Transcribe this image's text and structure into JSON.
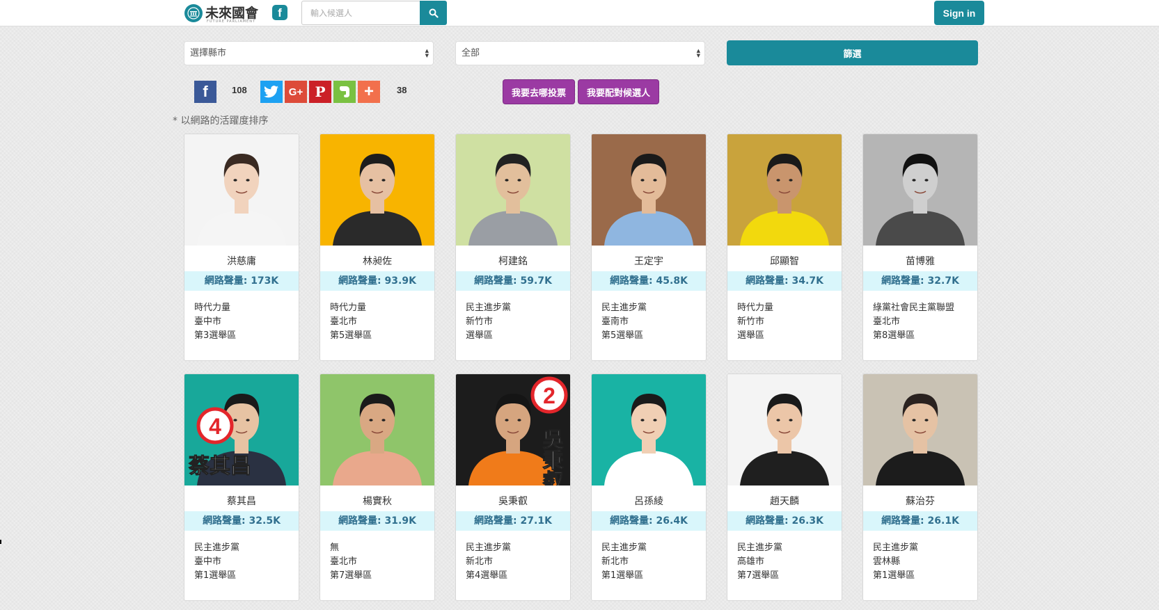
{
  "header": {
    "logo_text": "未來國會",
    "logo_sub": "FUTURE PARLIAMENT",
    "search": {
      "placeholder": "輸入候選人",
      "value": ""
    },
    "signin_label": "Sign in"
  },
  "filters": {
    "county_select": "選擇縣市",
    "party_select": "全部",
    "filter_button": "篩選"
  },
  "share": {
    "facebook_count": "108",
    "total_count": "38"
  },
  "actions": {
    "where_to_vote": "我要去哪投票",
    "match_candidate": "我要配對候選人"
  },
  "sort_note": "* 以網路的活躍度排序",
  "volume_prefix": "網路聲量: ",
  "candidates": [
    {
      "name": "洪慈庸",
      "volume": "網路聲量: 173K",
      "party": "時代力量",
      "city": "臺中市",
      "district": "第3選舉區",
      "bg": "#f4f4f4",
      "shirt": "#f5f5f5",
      "pants": "#6e87a6",
      "skin": "#f1d3bd",
      "hair": "#3a2a22"
    },
    {
      "name": "林昶佐",
      "volume": "網路聲量: 93.9K",
      "party": "時代力量",
      "city": "臺北市",
      "district": "第5選舉區",
      "bg": "#f8b400",
      "shirt": "#2a2a2a",
      "pants": "#2a2a2a",
      "skin": "#e6c0a2",
      "hair": "#1d1d1d"
    },
    {
      "name": "柯建銘",
      "volume": "網路聲量: 59.7K",
      "party": "民主進步黨",
      "city": "新竹市",
      "district": "選舉區",
      "bg": "#cfe0a2",
      "shirt": "#9a9ea4",
      "pants": "#9a9ea4",
      "skin": "#e2bf9c",
      "hair": "#222222"
    },
    {
      "name": "王定宇",
      "volume": "網路聲量: 45.8K",
      "party": "民主進步黨",
      "city": "臺南市",
      "district": "第5選舉區",
      "bg": "#9a6a4a",
      "shirt": "#8fb6e0",
      "pants": "#8fb6e0",
      "skin": "#e3bb99",
      "hair": "#1a1a1a"
    },
    {
      "name": "邱顯智",
      "volume": "網路聲量: 34.7K",
      "party": "時代力量",
      "city": "新竹市",
      "district": "選舉區",
      "bg": "#c9a33c",
      "shirt": "#f2d90d",
      "pants": "#2a2a2a",
      "skin": "#c9956d",
      "hair": "#1a1a1a"
    },
    {
      "name": "苗博雅",
      "volume": "網路聲量: 32.7K",
      "party": "綠黨社會民主黨聯盟",
      "city": "臺北市",
      "district": "第8選舉區",
      "bg": "#b5b5b5",
      "shirt": "#4a4a4a",
      "pants": "#4a4a4a",
      "skin": "#cfcfcf",
      "hair": "#111111"
    },
    {
      "name": "蔡其昌",
      "volume": "網路聲量: 32.5K",
      "party": "民主進步黨",
      "city": "臺中市",
      "district": "第1選舉區",
      "bg": "#18a89a",
      "shirt": "#2a3142",
      "pants": "#2a3142",
      "skin": "#e7c3a3",
      "hair": "#1a1a1a",
      "badge": "4",
      "slogan": "蔡其昌"
    },
    {
      "name": "楊實秋",
      "volume": "網路聲量: 31.9K",
      "party": "無",
      "city": "臺北市",
      "district": "第7選舉區",
      "bg": "#8fc56a",
      "shirt": "#e9a88c",
      "pants": "#e9a88c",
      "skin": "#d9a883",
      "hair": "#1a1a1a"
    },
    {
      "name": "吳秉叡",
      "volume": "網路聲量: 27.1K",
      "party": "民主進步黨",
      "city": "新北市",
      "district": "第4選舉區",
      "bg": "#1c1c1c",
      "shirt": "#f07b1a",
      "pants": "#f07b1a",
      "skin": "#d6a57f",
      "hair": "#151515",
      "badge": "2",
      "slogan": "吳秉叡"
    },
    {
      "name": "呂孫綾",
      "volume": "網路聲量: 26.4K",
      "party": "民主進步黨",
      "city": "新北市",
      "district": "第1選舉區",
      "bg": "#19b3a4",
      "shirt": "#ffffff",
      "pants": "#ffffff",
      "skin": "#f0cfb4",
      "hair": "#1a1a1a"
    },
    {
      "name": "趙天麟",
      "volume": "網路聲量: 26.3K",
      "party": "民主進步黨",
      "city": "高雄市",
      "district": "第7選舉區",
      "bg": "#f4f4f4",
      "shirt": "#1f1f1f",
      "pants": "#1f1f1f",
      "skin": "#ecc6a8",
      "hair": "#1a1a1a"
    },
    {
      "name": "蘇治芬",
      "volume": "網路聲量: 26.1K",
      "party": "民主進步黨",
      "city": "雲林縣",
      "district": "第1選舉區",
      "bg": "#c9c2b4",
      "shirt": "#1c1c1c",
      "pants": "#1c1c1c",
      "skin": "#e5c2a4",
      "hair": "#2a2220"
    }
  ]
}
